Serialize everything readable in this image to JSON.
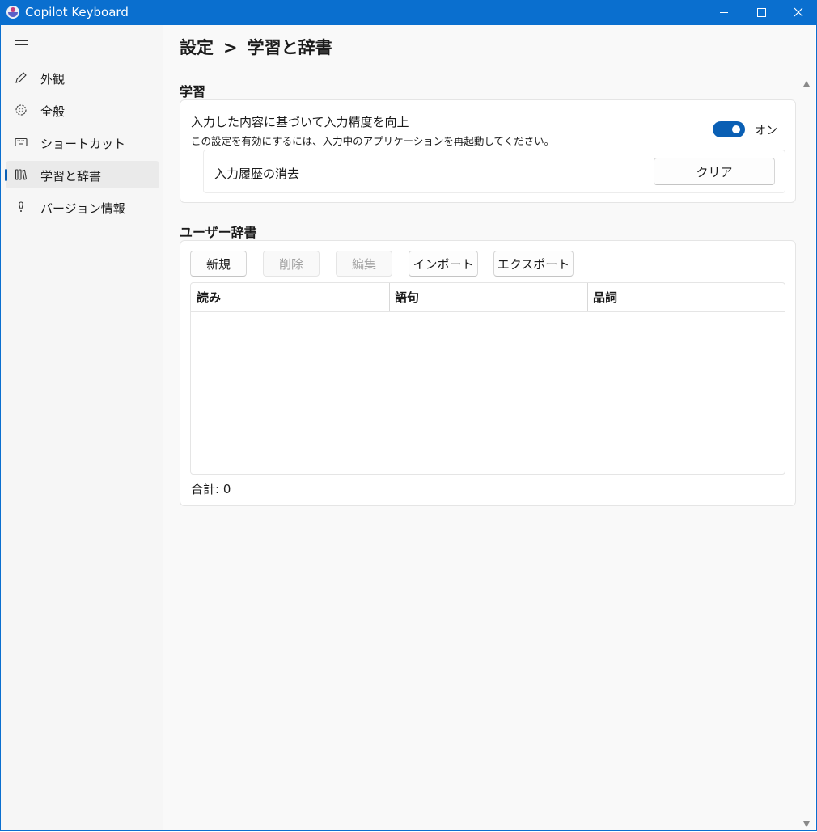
{
  "window": {
    "title": "Copilot Keyboard"
  },
  "sidebar": {
    "items": [
      {
        "label": "外観",
        "icon": "pencil-icon"
      },
      {
        "label": "全般",
        "icon": "gear-icon"
      },
      {
        "label": "ショートカット",
        "icon": "keyboard-icon"
      },
      {
        "label": "学習と辞書",
        "icon": "library-icon",
        "selected": true
      },
      {
        "label": "バージョン情報",
        "icon": "info-icon"
      }
    ]
  },
  "main": {
    "breadcrumb": {
      "root": "設定",
      "separator": ">",
      "current": "学習と辞書"
    },
    "learning": {
      "title": "学習",
      "toggle_label": "入力した内容に基づいて入力精度を向上",
      "toggle_description": "この設定を有効にするには、入力中のアプリケーションを再起動してください。",
      "toggle_state": "オン",
      "toggle_on": true,
      "clear_history_label": "入力履歴の消去",
      "clear_button": "クリア"
    },
    "dictionary": {
      "title": "ユーザー辞書",
      "buttons": {
        "new": "新規",
        "delete": "削除",
        "edit": "編集",
        "import": "インポート",
        "export": "エクスポート"
      },
      "columns": [
        "読み",
        "語句",
        "品詞"
      ],
      "rows": [],
      "total_label": "合計:",
      "total_value": "0"
    }
  },
  "colors": {
    "accent": "#0a5fb4",
    "titlebar": "#0a6fcf"
  }
}
